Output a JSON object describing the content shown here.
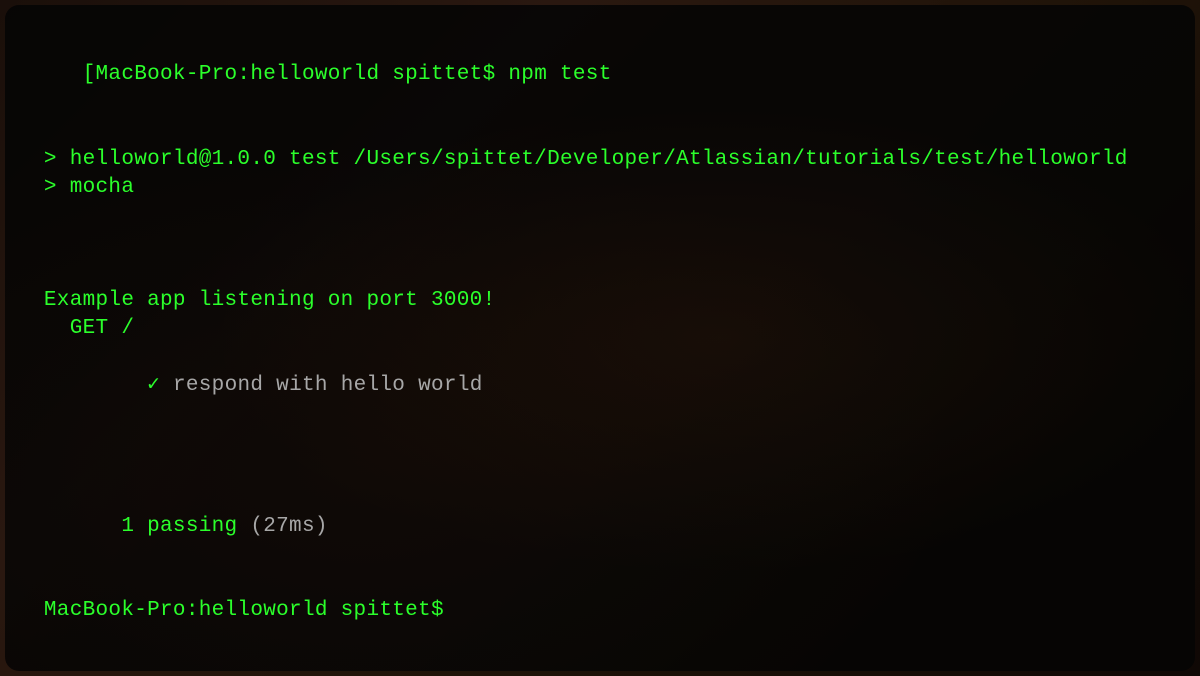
{
  "prompt1": {
    "prefix": "[MacBook-Pro:helloworld spittet$ ",
    "command": "npm test"
  },
  "npm_output": {
    "line1": " > helloworld@1.0.0 test /Users/spittet/Developer/Atlassian/tutorials/test/helloworld",
    "line2": " > mocha"
  },
  "app_message": " Example app listening on port 3000!",
  "test_suite": "   GET /",
  "test_result": {
    "check": "     ✓ ",
    "description": "respond with hello world"
  },
  "summary": {
    "passing": "   1 passing ",
    "time": "(27ms)"
  },
  "prompt2": " MacBook-Pro:helloworld spittet$ "
}
